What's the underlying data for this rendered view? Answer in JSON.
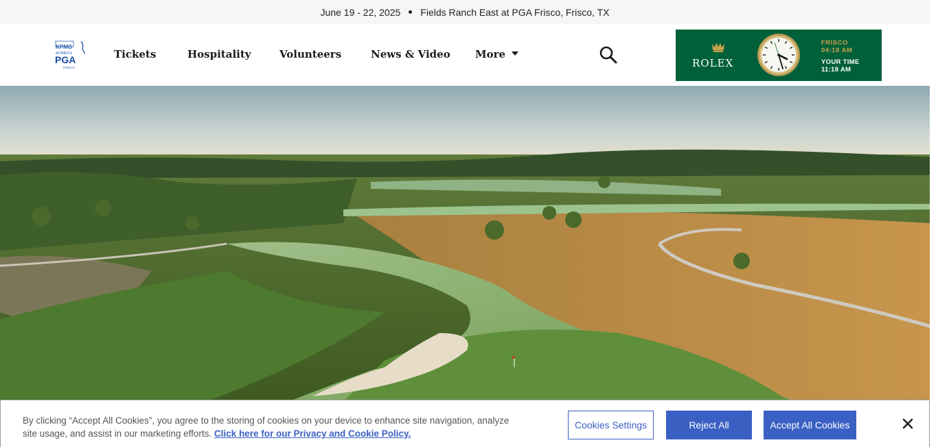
{
  "topbar": {
    "dates": "June 19 - 22, 2025",
    "venue": "Fields Ranch East at PGA Frisco, Frisco, TX"
  },
  "logo": {
    "line1": "KPMG",
    "line2": "WOMEN'S",
    "line3": "PGA",
    "line4": "FRISCO"
  },
  "nav": {
    "items": [
      {
        "label": "Tickets"
      },
      {
        "label": "Hospitality"
      },
      {
        "label": "Volunteers"
      },
      {
        "label": "News & Video"
      },
      {
        "label": "More"
      }
    ]
  },
  "icons": {
    "search": "search-icon",
    "caret": "caret-down-icon",
    "close": "close-icon",
    "crown": "rolex-crown-icon"
  },
  "rolex": {
    "brand": "ROLEX",
    "city_label": "FRISCO",
    "city_time": "04:18 AM",
    "your_label": "YOUR TIME",
    "your_time": "11:18 AM",
    "colors": {
      "green": "#006039",
      "gold": "#c9a24c"
    }
  },
  "cookie": {
    "text": "By clicking “Accept All Cookies”, you agree to the storing of cookies on your device to enhance site navigation, analyze site usage, and assist in our marketing efforts.",
    "policy_link": "Click here for our Privacy and Cookie Policy.",
    "settings_button": "Cookies Settings",
    "reject_button": "Reject All",
    "accept_button": "Accept All Cookies",
    "accent_color": "#3b60c4"
  }
}
